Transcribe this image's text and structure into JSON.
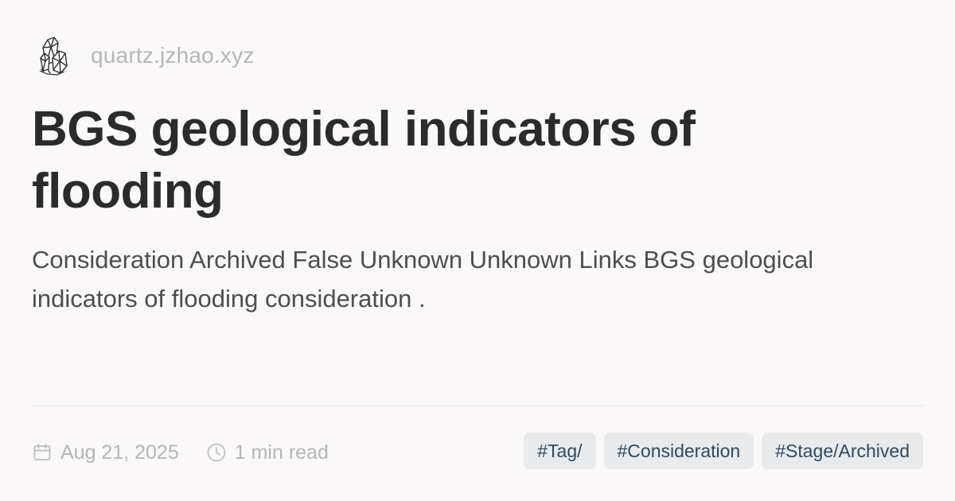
{
  "site": {
    "name": "quartz.jzhao.xyz",
    "logo_icon": "crystal-logo-icon"
  },
  "article": {
    "title": "BGS geological indicators of flooding",
    "description": "Consideration Archived False Unknown Unknown Links BGS geological indicators of flooding consideration ."
  },
  "meta": {
    "date": "Aug 21, 2025",
    "date_icon": "calendar-icon",
    "reading_time": "1 min read",
    "reading_time_icon": "clock-icon"
  },
  "tags": [
    {
      "label": "#Tag/"
    },
    {
      "label": "#Consideration"
    },
    {
      "label": "#Stage/Archived"
    }
  ],
  "colors": {
    "background": "#faf8f8",
    "title": "#2b2b2b",
    "muted": "#b6b6b6",
    "tag_background": "#e9eaec",
    "tag_text": "#2f4a63"
  }
}
